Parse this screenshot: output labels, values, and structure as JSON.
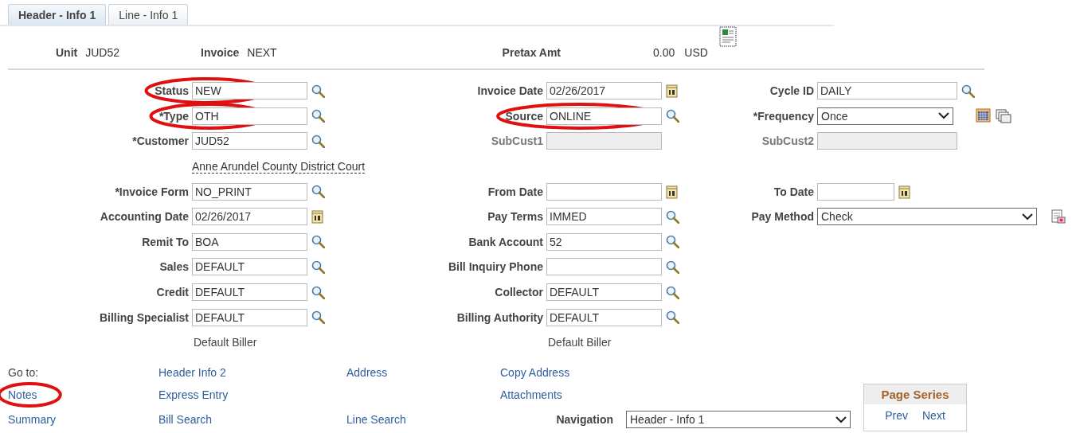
{
  "tabs": [
    {
      "label": "Header - Info 1",
      "selected": true
    },
    {
      "label": "Line - Info 1",
      "selected": false
    }
  ],
  "header": {
    "unit_label": "Unit",
    "unit": "JUD52",
    "invoice_label": "Invoice",
    "invoice": "NEXT",
    "pretax_label": "Pretax Amt",
    "pretax": "0.00",
    "currency": "USD"
  },
  "form": {
    "rows": [
      {
        "left": {
          "label": "Status",
          "value": "NEW",
          "kind": "lookup",
          "circled": true
        },
        "middle": {
          "label": "Invoice Date",
          "value": "02/26/2017",
          "kind": "date",
          "circled": false
        },
        "right": {
          "label": "Cycle ID",
          "value": "DAILY",
          "kind": "lookup",
          "circled": false
        }
      },
      {
        "left": {
          "label": "*Type",
          "value": "OTH",
          "kind": "lookup",
          "circled": true
        },
        "middle": {
          "label": "Source",
          "value": "ONLINE",
          "kind": "lookup",
          "circled": true
        },
        "right": {
          "label": "*Frequency",
          "value": "Once",
          "kind": "frequency-select",
          "circled": false
        }
      },
      {
        "left": {
          "label": "*Customer",
          "value": "JUD52",
          "kind": "lookup",
          "circled": false
        },
        "middle": {
          "label": "SubCust1",
          "kind": "disabled",
          "circled": false
        },
        "right": {
          "label": "SubCust2",
          "kind": "disabled",
          "circled": false
        }
      },
      {
        "left": {
          "value": "Anne Arundel County District Court",
          "kind": "link"
        }
      },
      {
        "left": {
          "label": "*Invoice Form",
          "value": "NO_PRINT",
          "kind": "lookup",
          "circled": false
        },
        "middle": {
          "label": "From Date",
          "kind": "date",
          "circled": false
        },
        "right": {
          "label": "To Date",
          "kind": "date",
          "circled": false
        }
      },
      {
        "left": {
          "label": "Accounting Date",
          "value": "02/26/2017",
          "kind": "date",
          "circled": false
        },
        "middle": {
          "label": "Pay Terms",
          "value": "IMMED",
          "kind": "lookup",
          "circled": false
        },
        "right": {
          "label": "Pay Method",
          "value": "Check",
          "kind": "paymethod-select",
          "circled": false
        }
      },
      {
        "left": {
          "label": "Remit To",
          "value": "BOA",
          "kind": "lookup",
          "circled": false
        },
        "middle": {
          "label": "Bank Account",
          "value": "52",
          "kind": "lookup",
          "circled": false
        }
      },
      {
        "left": {
          "label": "Sales",
          "value": "DEFAULT",
          "kind": "lookup",
          "circled": false
        },
        "middle": {
          "label": "Bill Inquiry Phone",
          "kind": "lookup",
          "circled": false
        }
      },
      {
        "left": {
          "label": "Credit",
          "value": "DEFAULT",
          "kind": "lookup",
          "circled": false
        },
        "middle": {
          "label": "Collector",
          "value": "DEFAULT",
          "kind": "lookup",
          "circled": false
        }
      },
      {
        "left": {
          "label": "Billing Specialist",
          "value": "DEFAULT",
          "kind": "lookup",
          "circled": false
        },
        "middle": {
          "label": "Billing Authority",
          "value": "DEFAULT",
          "kind": "lookup",
          "circled": false
        }
      },
      {
        "left": {
          "value": "Default Biller",
          "kind": "note"
        },
        "middle": {
          "value": "Default Biller",
          "kind": "note"
        }
      }
    ]
  },
  "goto": {
    "rows": [
      {
        "cells": [
          {
            "text": "Go to:",
            "kind": "label",
            "circled": false
          },
          {
            "text": "Header Info 2",
            "kind": "link",
            "circled": false
          },
          {
            "text": "Address",
            "kind": "link",
            "circled": false
          },
          {
            "text": "Copy Address",
            "kind": "link",
            "circled": false
          }
        ]
      },
      {
        "cells": [
          {
            "text": "Notes",
            "kind": "link",
            "circled": true
          },
          {
            "text": "Express Entry",
            "kind": "link",
            "circled": false
          },
          null,
          {
            "text": "Attachments",
            "kind": "link",
            "circled": false
          }
        ]
      },
      {
        "cells": [
          {
            "text": "Summary",
            "kind": "link",
            "circled": false
          },
          {
            "text": "Bill Search",
            "kind": "link",
            "circled": false
          },
          {
            "text": "Line Search",
            "kind": "link",
            "circled": false
          }
        ]
      }
    ]
  },
  "navigation": {
    "label": "Navigation",
    "value": "Header - Info 1"
  },
  "page_series": {
    "title": "Page Series",
    "prev": "Prev",
    "next": "Next"
  }
}
